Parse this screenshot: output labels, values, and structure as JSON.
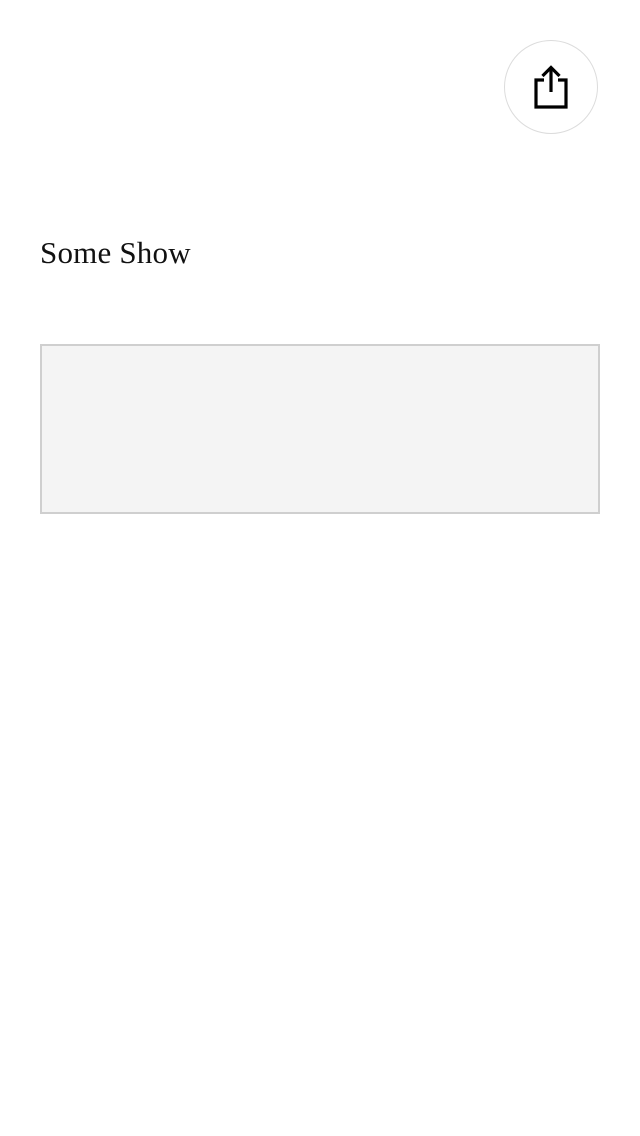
{
  "header": {
    "share_icon": "share-icon"
  },
  "show": {
    "title": "Some Show"
  },
  "colors": {
    "background": "#ffffff",
    "text": "#111111",
    "box_fill": "#f4f4f4",
    "box_border": "#cfcfcf",
    "button_border": "#dcdcdc"
  }
}
